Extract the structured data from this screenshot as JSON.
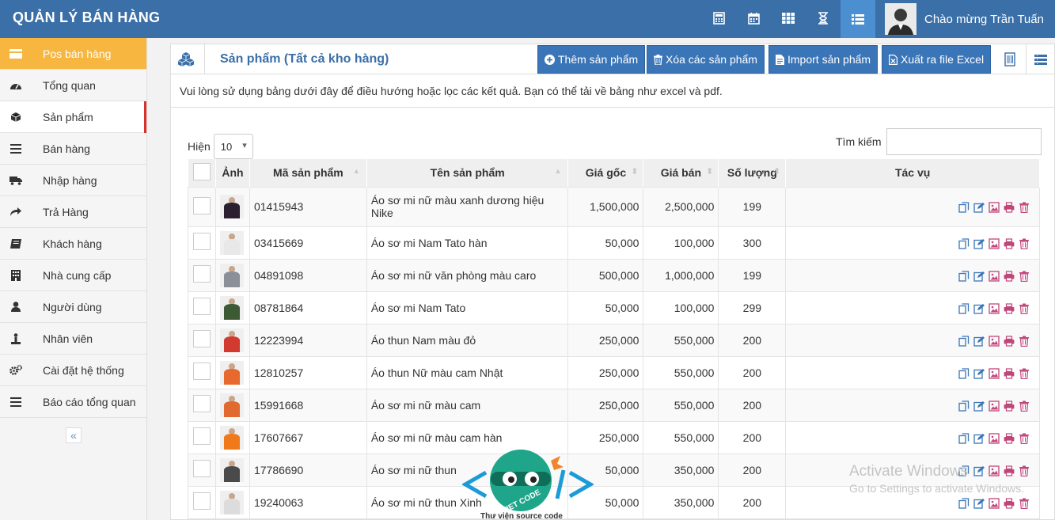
{
  "app": {
    "brand": "QUẢN LÝ BÁN HÀNG",
    "greeting": "Chào mừng Trần Tuấn",
    "toolbar_icons": [
      "calculator-icon",
      "calendar-icon",
      "grid-icon",
      "hourglass-icon",
      "list-icon"
    ]
  },
  "sidebar": {
    "items": [
      {
        "label": "Pos bán hàng",
        "icon": "pos-icon"
      },
      {
        "label": "Tổng quan",
        "icon": "dashboard-icon"
      },
      {
        "label": "Sản phẩm",
        "icon": "cube-icon"
      },
      {
        "label": "Bán hàng",
        "icon": "bars-icon"
      },
      {
        "label": "Nhập hàng",
        "icon": "truck-icon"
      },
      {
        "label": "Trả Hàng",
        "icon": "share-icon"
      },
      {
        "label": "Khách hàng",
        "icon": "book-icon"
      },
      {
        "label": "Nhà cung cấp",
        "icon": "building-icon"
      },
      {
        "label": "Người dùng",
        "icon": "user-icon"
      },
      {
        "label": "Nhân viên",
        "icon": "staff-icon"
      },
      {
        "label": "Cài đặt hệ thống",
        "icon": "cogs-icon"
      },
      {
        "label": "Báo cáo tổng quan",
        "icon": "bars-icon"
      }
    ],
    "collapse_label": "«"
  },
  "panel": {
    "title": "Sản phẩm (Tất cả kho hàng)",
    "buttons": {
      "add": "Thêm sản phẩm",
      "delete": "Xóa các sản phẩm",
      "import": "Import sản phẩm",
      "export": "Xuất ra file Excel"
    },
    "help_text": "Vui lòng sử dụng bảng dưới đây để điều hướng hoặc lọc các kết quả. Bạn có thể tải về bảng như excel và pdf.",
    "length_label": "Hiện",
    "length_value": "10",
    "search_label": "Tìm kiếm",
    "search_value": ""
  },
  "table": {
    "headers": [
      "Ảnh",
      "Mã sản phẩm",
      "Tên sản phẩm",
      "Giá gốc",
      "Giá bán",
      "Số lượng",
      "Tác vụ"
    ],
    "rows": [
      {
        "code": "01415943",
        "name": "Áo sơ mi nữ màu xanh dương hiệu Nike",
        "cost": "1,500,000",
        "price": "2,500,000",
        "qty": "199",
        "thumb": "#2a2030"
      },
      {
        "code": "03415669",
        "name": "Áo sơ mi Nam Tato hàn",
        "cost": "50,000",
        "price": "100,000",
        "qty": "300",
        "thumb": "#e8e8e8"
      },
      {
        "code": "04891098",
        "name": "Áo sơ mi nữ văn phòng màu caro",
        "cost": "500,000",
        "price": "1,000,000",
        "qty": "199",
        "thumb": "#8a8f98"
      },
      {
        "code": "08781864",
        "name": "Áo sơ mi Nam Tato",
        "cost": "50,000",
        "price": "100,000",
        "qty": "299",
        "thumb": "#3d5a35"
      },
      {
        "code": "12223994",
        "name": "Áo thun Nam màu đỏ",
        "cost": "250,000",
        "price": "550,000",
        "qty": "200",
        "thumb": "#d23a30"
      },
      {
        "code": "12810257",
        "name": "Áo thun Nữ màu cam Nhật",
        "cost": "250,000",
        "price": "550,000",
        "qty": "200",
        "thumb": "#e8692e"
      },
      {
        "code": "15991668",
        "name": "Áo sơ mi nữ màu cam",
        "cost": "250,000",
        "price": "550,000",
        "qty": "200",
        "thumb": "#e06a2f"
      },
      {
        "code": "17607667",
        "name": "Áo sơ mi nữ màu cam hàn",
        "cost": "250,000",
        "price": "550,000",
        "qty": "200",
        "thumb": "#f07a1a"
      },
      {
        "code": "17786690",
        "name": "Áo sơ mi nữ thun",
        "cost": "50,000",
        "price": "350,000",
        "qty": "200",
        "thumb": "#4a4a4a"
      },
      {
        "code": "19240063",
        "name": "Áo sơ mi nữ thun Xinh",
        "cost": "50,000",
        "price": "350,000",
        "qty": "200",
        "thumb": "#dcdcdc"
      }
    ],
    "action_icons": [
      "copy-icon",
      "edit-icon",
      "image-icon",
      "print-icon",
      "trash-icon"
    ]
  },
  "watermark": {
    "line1": "Activate Windows",
    "line2": "Go to Settings to activate Windows."
  },
  "logo": {
    "tagline": "Thư viện source code",
    "badge": "VIET CODE"
  },
  "colors": {
    "header": "#3a6fa8",
    "active_sidebar": "#f7b640",
    "button": "#3a75b8",
    "current_marker": "#d9302c",
    "action_blue": "#3a75b8",
    "action_red": "#c0457a"
  }
}
